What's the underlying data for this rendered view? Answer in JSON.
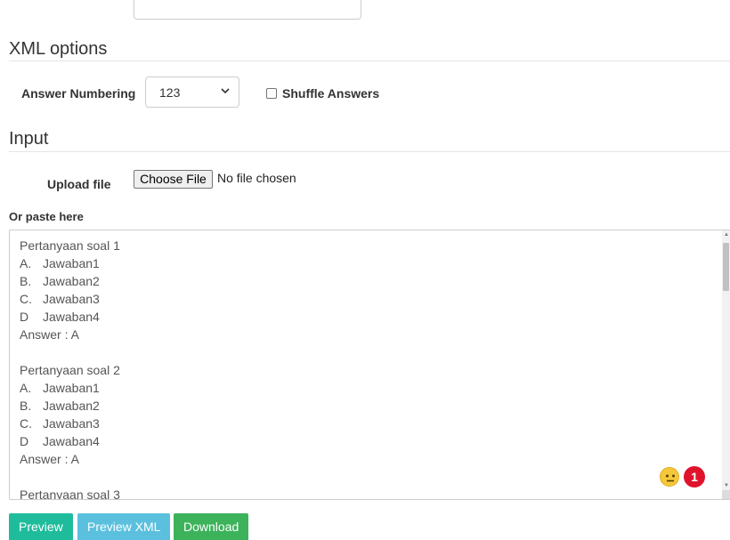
{
  "xml_options": {
    "heading": "XML options",
    "answer_numbering_label": "Answer Numbering",
    "answer_numbering_value": "123",
    "shuffle_label": "Shuffle Answers",
    "shuffle_checked": false
  },
  "input": {
    "heading": "Input",
    "upload_label": "Upload file",
    "choose_file_label": "Choose File",
    "file_status": "No file chosen",
    "paste_label": "Or paste here",
    "textarea_lines": [
      "Pertanyaan soal 1",
      "A.\tJawaban1",
      "B.\tJawaban2",
      "C.\tJawaban3",
      "D\tJawaban4",
      "Answer : A",
      "",
      "Pertanyaan soal 2",
      "A.\tJawaban1",
      "B.\tJawaban2",
      "C.\tJawaban3",
      "D\tJawaban4",
      "Answer : A",
      "",
      "Pertanyaan soal 3"
    ]
  },
  "overlay": {
    "emoji_icon": "neutral-face-icon",
    "badge_count": "1",
    "badge_color": "#e0132d"
  },
  "actions": {
    "preview_label": "Preview",
    "preview_xml_label": "Preview XML",
    "download_label": "Download",
    "colors": {
      "preview": "#1fbc9c",
      "preview_xml": "#5bc0de",
      "download": "#3cb35a"
    }
  }
}
